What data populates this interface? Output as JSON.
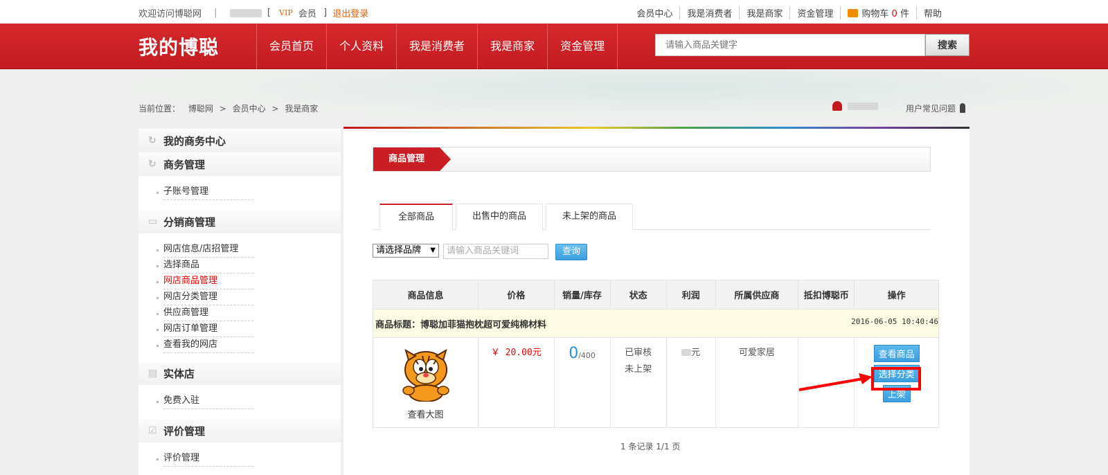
{
  "topbar": {
    "welcome": "欢迎访问博聪网",
    "sep": "|",
    "bracket_open": "[",
    "vip": "VIP",
    "member": "会员",
    "bracket_close": "]",
    "logout": "退出登录",
    "links": [
      "会员中心",
      "我是消费者",
      "我是商家",
      "资金管理"
    ],
    "cart_label": "购物车",
    "cart_count": "0",
    "cart_unit": "件",
    "help": "帮助"
  },
  "header": {
    "logo": "我的博聪",
    "nav": [
      "会员首页",
      "个人资料",
      "我是消费者",
      "我是商家",
      "资金管理"
    ],
    "search_placeholder": "请输入商品关键字",
    "search_button": "搜索"
  },
  "crumbs": {
    "label": "当前位置：",
    "items": [
      "博聪网",
      "会员中心",
      "我是商家"
    ],
    "sep": ">",
    "faq": "用户常见问题"
  },
  "sidebar": {
    "sections": [
      {
        "title": "我的商务中心",
        "items": []
      },
      {
        "title": "商务管理",
        "items": [
          "子账号管理"
        ]
      },
      {
        "title": "分销商管理",
        "items": [
          "网店信息/店招管理",
          "选择商品",
          "网店商品管理",
          "网店分类管理",
          "供应商管理",
          "网店订单管理",
          "查看我的网店"
        ]
      },
      {
        "title": "实体店",
        "items": [
          "免费入驻"
        ]
      },
      {
        "title": "评价管理",
        "items": [
          "评价管理"
        ]
      }
    ],
    "active_item": "网店商品管理"
  },
  "main": {
    "panel_title": "商品管理",
    "tabs": [
      "全部商品",
      "出售中的商品",
      "未上架的商品"
    ],
    "brand_select": "请选择品牌",
    "keyword_placeholder": "请输入商品关键词",
    "query_button": "查询",
    "columns": [
      "商品信息",
      "价格",
      "销量/库存",
      "状态",
      "利润",
      "所属供应商",
      "抵扣博聪币",
      "操作"
    ],
    "product": {
      "title": "商品标题：博聪加菲猫抱枕超可爱纯棉材料",
      "date": "2016-06-05 10:40:46",
      "view_image": "查看大图",
      "price": "￥ 20.00元",
      "sold": "0",
      "stock": "/400",
      "status1": "已审核",
      "status2": "未上架",
      "profit_suffix": "元",
      "supplier": "可爱家居",
      "actions": [
        "查看商品",
        "选择分类",
        "上架"
      ]
    },
    "pager": "1 条记录 1/1 页"
  }
}
